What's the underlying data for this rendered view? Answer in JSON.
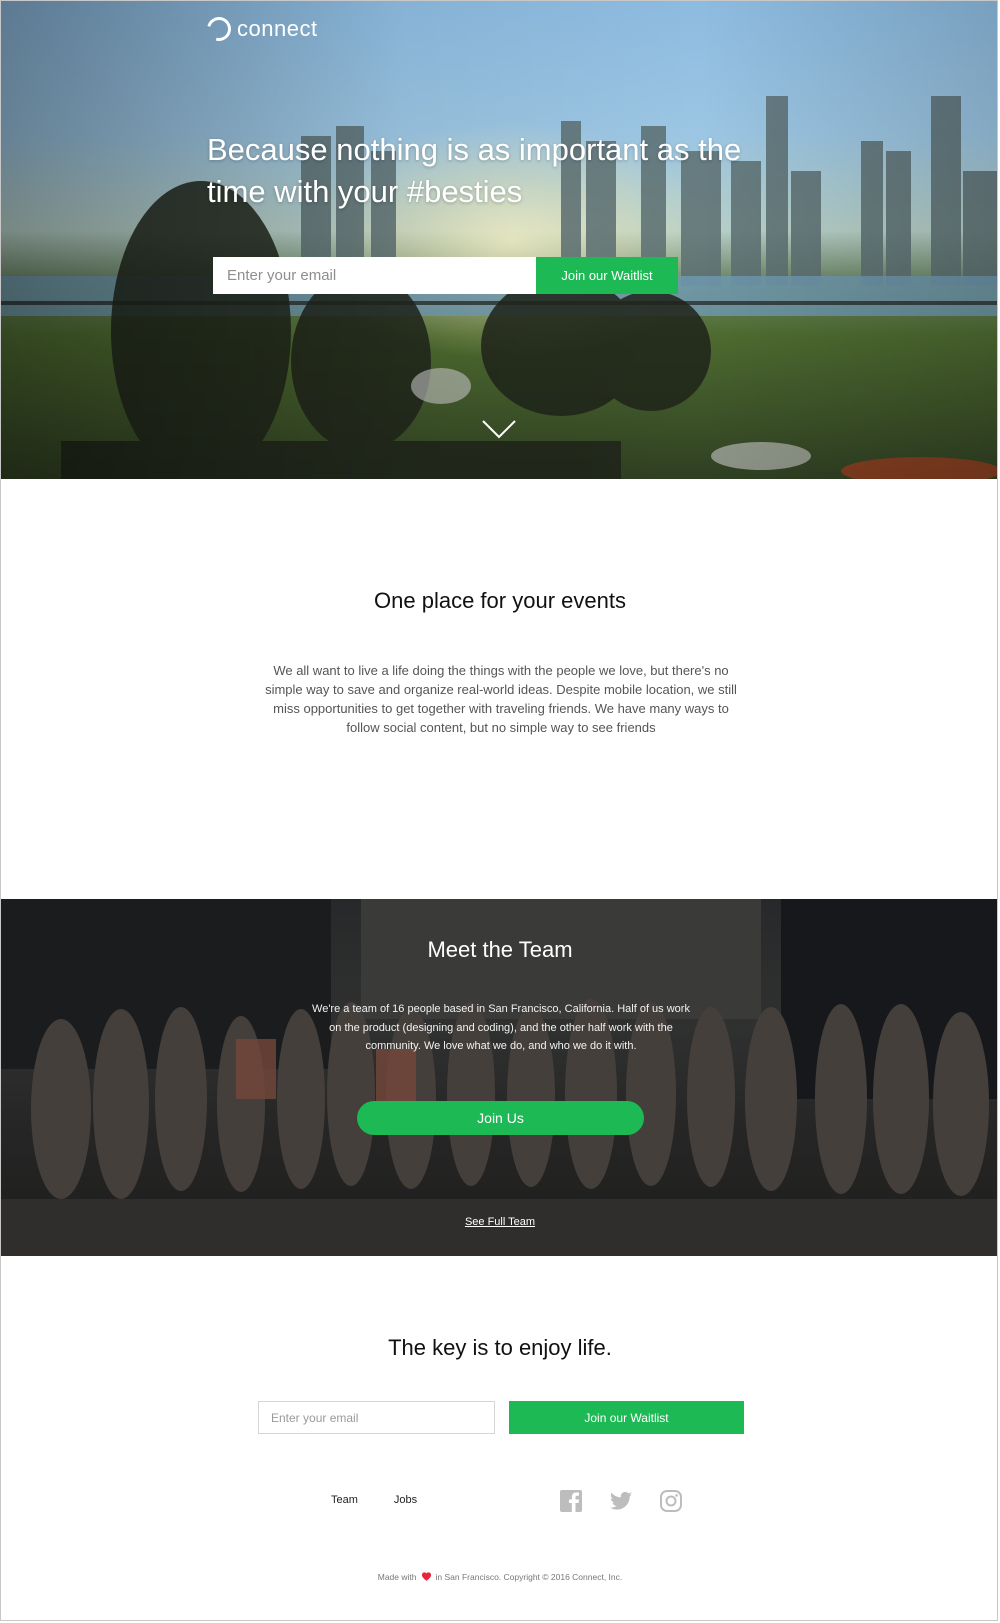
{
  "header": {
    "logo_text": "connect"
  },
  "hero": {
    "title": "Because nothing is as important as the time with your #besties",
    "email_placeholder": "Enter your email",
    "button_label": "Join our Waitlist"
  },
  "events": {
    "title": "One place for your events",
    "description": "We all want to live a life doing the things with the people we love, but there's no simple way to save and organize real-world ideas. Despite mobile location, we still miss opportunities to get together with traveling friends. We have many ways to follow social content, but no simple way to see friends"
  },
  "team": {
    "title": "Meet the Team",
    "description": "We're a team of 16 people based in San Francisco, California. Half of us work on the product (designing and coding), and the other half work with the community. We love what we do, and who we do it with.",
    "button_label": "Join Us",
    "link_label": "See Full Team"
  },
  "signup": {
    "title": "The key is to enjoy life.",
    "email_placeholder": "Enter your email",
    "button_label": "Join our Waitlist"
  },
  "footer": {
    "links": [
      "Team",
      "Jobs"
    ],
    "social_icons": [
      "facebook-icon",
      "twitter-icon",
      "instagram-icon"
    ],
    "made_with": "Made with",
    "copyright": "in San Francisco. Copyright © 2016 Connect, Inc."
  },
  "colors": {
    "accent": "#1db954",
    "heart": "#e8253d"
  }
}
